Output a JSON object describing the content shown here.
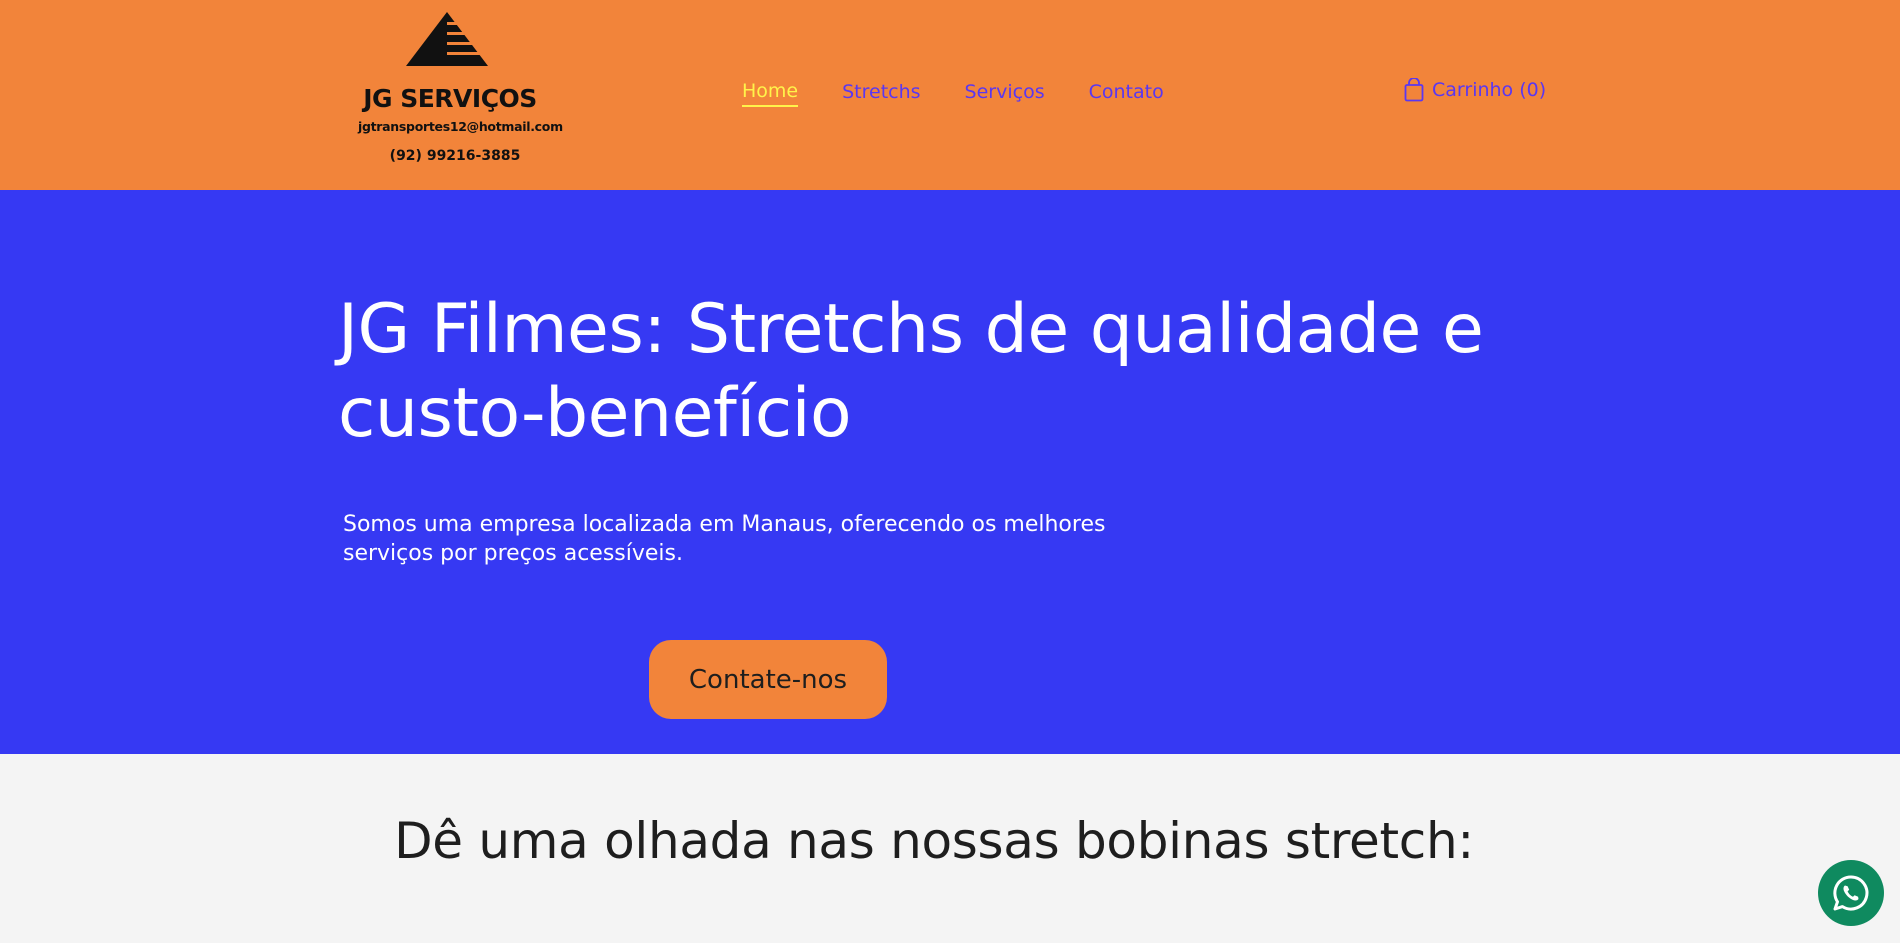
{
  "colors": {
    "header_bg": "#f2843a",
    "hero_bg": "#3639f3",
    "nav_link": "#5a37f2",
    "nav_active": "#fff34a",
    "button_bg": "#f2843a",
    "section_bg": "#f4f4f4",
    "whatsapp_bg": "#0f8a5f"
  },
  "header": {
    "logo": {
      "name": "JG SERVIÇOS",
      "email": "jgtransportes12@hotmail.com",
      "phone": "(92) 99216-3885",
      "icon": "pyramid-logo-icon"
    },
    "nav": [
      {
        "label": "Home",
        "active": true
      },
      {
        "label": "Stretchs",
        "active": false
      },
      {
        "label": "Serviços",
        "active": false
      },
      {
        "label": "Contato",
        "active": false
      }
    ],
    "cart": {
      "label": "Carrinho (0)",
      "icon": "shopping-bag-icon"
    }
  },
  "hero": {
    "title": "JG Filmes: Stretchs de qualidade e custo-benefício",
    "subtitle": "Somos uma empresa localizada em Manaus, oferecendo os melhores serviços por preços acessíveis.",
    "button_label": "Contate-nos"
  },
  "section": {
    "title": "Dê uma olhada nas nossas bobinas stretch:"
  },
  "floating": {
    "icon": "whatsapp-icon"
  }
}
